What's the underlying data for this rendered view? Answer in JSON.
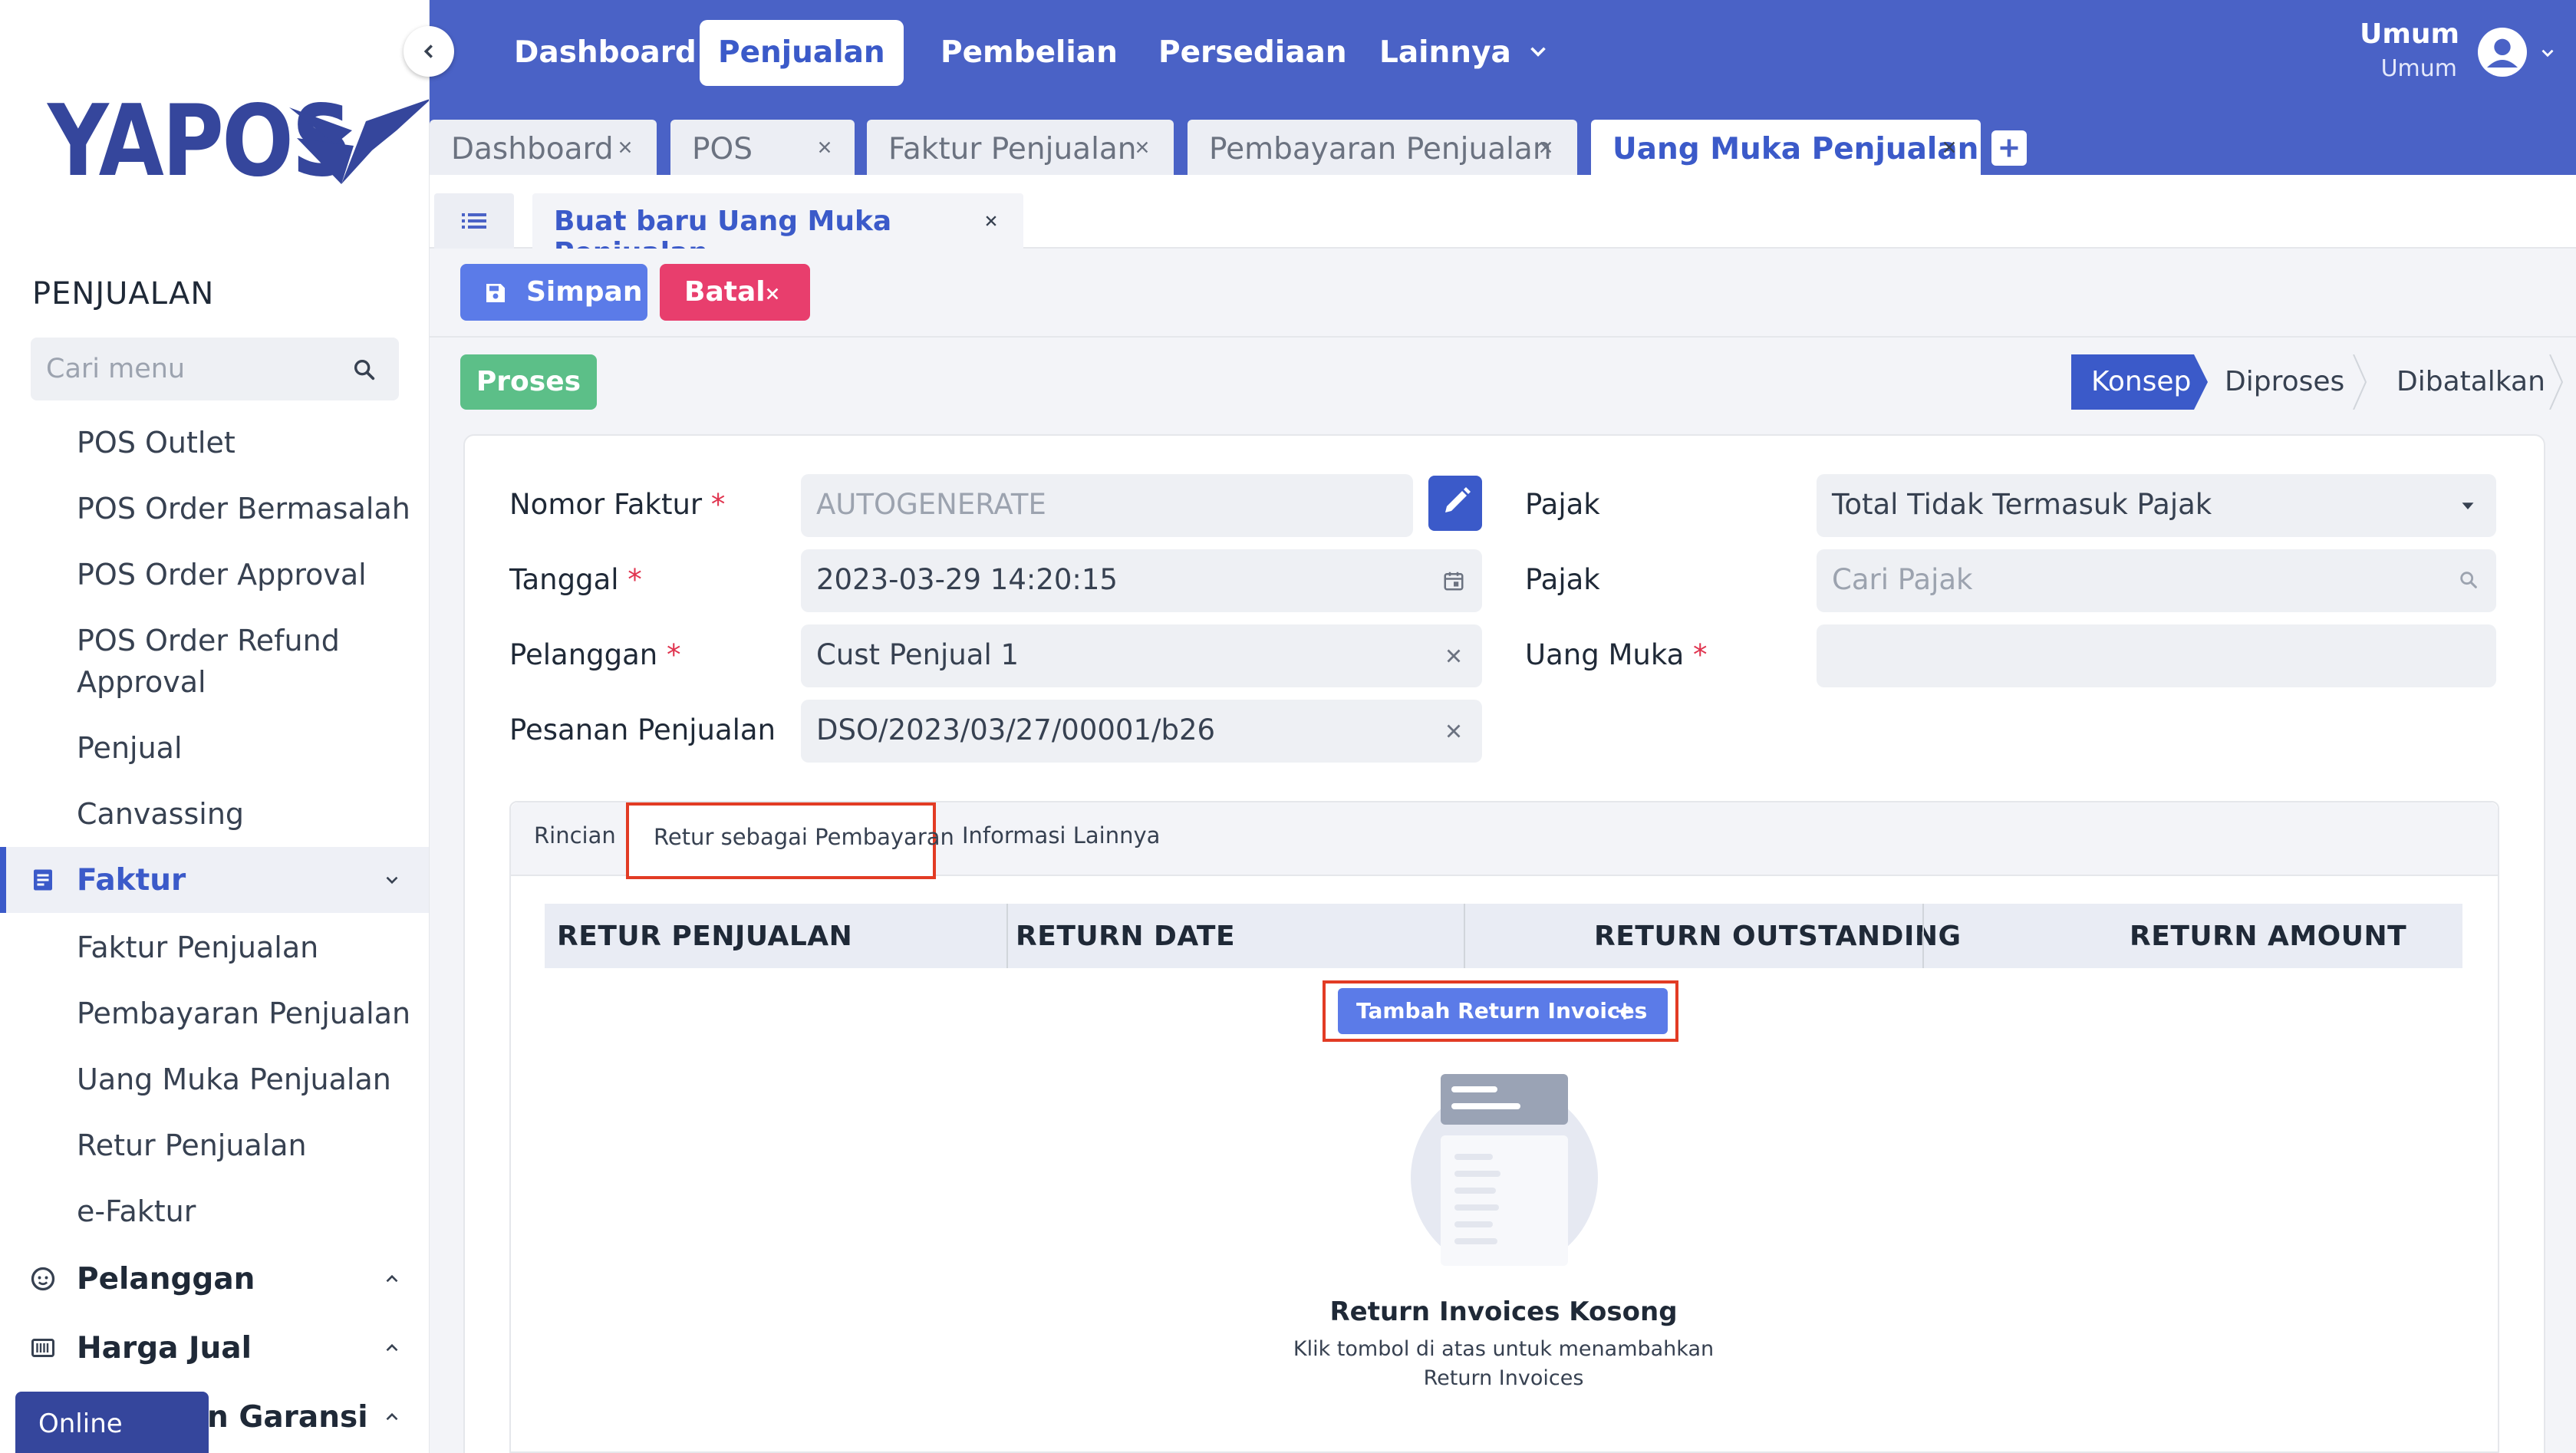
{
  "sidebar": {
    "logo_text": "YAPOS",
    "section_title": "PENJUALAN",
    "search_placeholder": "Cari menu",
    "items": {
      "pos_outlet": "POS Outlet",
      "pos_order_bermasalah": "POS Order Bermasalah",
      "pos_order_approval": "POS Order Approval",
      "pos_order_refund_line1": "POS Order Refund",
      "pos_order_refund_line2": "Approval",
      "penjual": "Penjual",
      "canvassing": "Canvassing"
    },
    "group_faktur": {
      "label": "Faktur",
      "items": {
        "faktur_penjualan": "Faktur Penjualan",
        "pembayaran_penjualan": "Pembayaran Penjualan",
        "uang_muka_penjualan": "Uang Muka Penjualan",
        "retur_penjualan": "Retur Penjualan",
        "e_faktur": "e-Faktur"
      }
    },
    "group_pelanggan": "Pelanggan",
    "group_harga_jual": "Harga Jual",
    "group_garansi": "n Garansi",
    "online_badge": "Online"
  },
  "topnav": {
    "items": {
      "dashboard": "Dashboard",
      "penjualan": "Penjualan",
      "pembelian": "Pembelian",
      "persediaan": "Persediaan",
      "lainnya": "Lainnya"
    },
    "user_name": "Umum",
    "user_role": "Umum"
  },
  "doc_tabs": {
    "dashboard": "Dashboard",
    "pos": "POS",
    "faktur_penjualan": "Faktur Penjualan",
    "pembayaran_penjualan": "Pembayaran Penjualan",
    "uang_muka_penjualan": "Uang Muka Penjualan"
  },
  "subtab": {
    "label": "Buat baru Uang Muka Penjualan"
  },
  "actions": {
    "simpan": "Simpan",
    "batal": "Batal",
    "proses": "Proses"
  },
  "status_steps": {
    "konsep": "Konsep",
    "diproses": "Diproses",
    "dibatalkan": "Dibatalkan"
  },
  "form": {
    "nomor_faktur": {
      "label": "Nomor Faktur",
      "value": "AUTOGENERATE"
    },
    "tanggal": {
      "label": "Tanggal",
      "value": "2023-03-29  14:20:15"
    },
    "pelanggan": {
      "label": "Pelanggan",
      "value": "Cust Penjual 1"
    },
    "pesanan_penjualan": {
      "label": "Pesanan Penjualan",
      "value": "DSO/2023/03/27/00001/b26"
    },
    "pajak_type": {
      "label": "Pajak",
      "value": "Total Tidak Termasuk Pajak"
    },
    "pajak_search": {
      "label": "Pajak",
      "placeholder": "Cari Pajak"
    },
    "uang_muka": {
      "label": "Uang Muka",
      "value": ""
    },
    "required_mark": "*"
  },
  "detail_tabs": {
    "rincian": "Rincian",
    "retur": "Retur sebagai Pembayaran",
    "informasi": "Informasi Lainnya"
  },
  "grid": {
    "columns": {
      "retur_penjualan": "RETUR PENJUALAN",
      "return_date": "RETURN DATE",
      "return_outstanding": "RETURN OUTSTANDING",
      "return_amount": "RETURN AMOUNT"
    },
    "add_button": "Tambah Return Invoices",
    "empty_title": "Return Invoices Kosong",
    "empty_desc": "Klik tombol di atas untuk menambahkan Return Invoices"
  },
  "colors": {
    "primary": "#4a62c6",
    "accent_blue": "#3b5ac9",
    "button_blue": "#5b7be8",
    "danger": "#e83e6d",
    "success": "#5cbf88",
    "highlight_box": "#e23b24"
  }
}
